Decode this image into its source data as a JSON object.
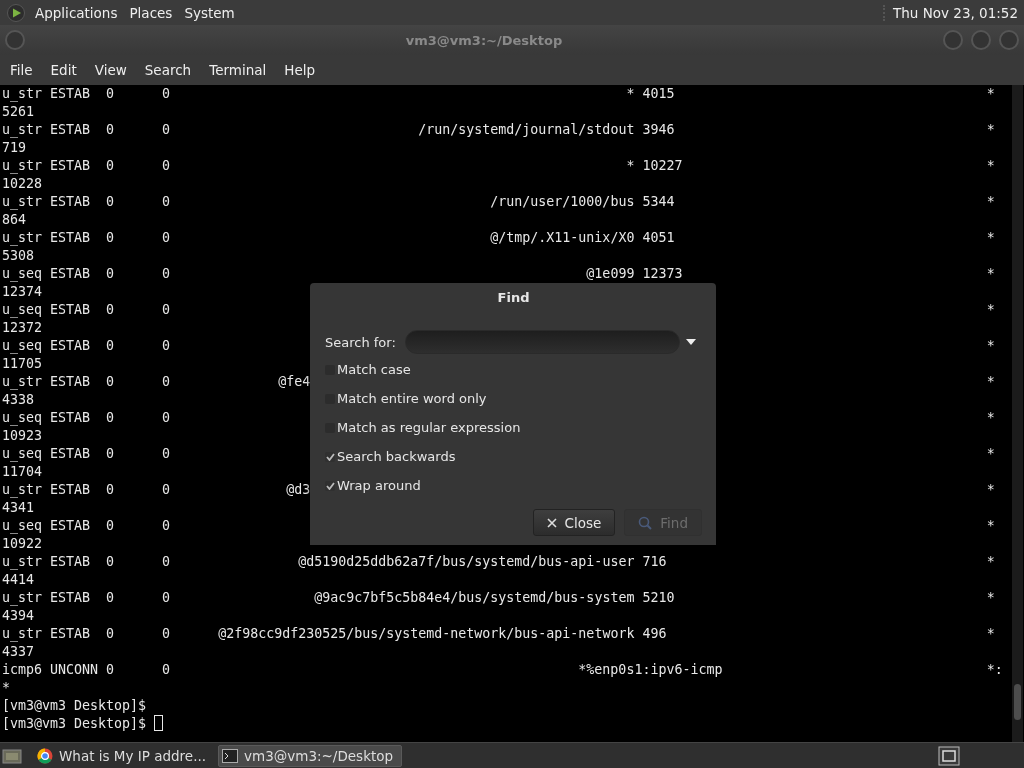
{
  "top_panel": {
    "menus": [
      "Applications",
      "Places",
      "System"
    ],
    "clock": "Thu Nov 23, 01:52"
  },
  "window": {
    "title": "vm3@vm3:~/Desktop",
    "menu": [
      "File",
      "Edit",
      "View",
      "Search",
      "Terminal",
      "Help"
    ]
  },
  "terminal": {
    "rows": [
      {
        "kind": "unix",
        "netid": "u_str",
        "state": "ESTAB",
        "recv_q": "0",
        "send_q": "0",
        "local": "*",
        "local_port": "4015",
        "peer": "*",
        "peer_port": "5261"
      },
      {
        "kind": "unix",
        "netid": "u_str",
        "state": "ESTAB",
        "recv_q": "0",
        "send_q": "0",
        "local": "/run/systemd/journal/stdout",
        "local_port": "3946",
        "peer": "*",
        "peer_port": "719"
      },
      {
        "kind": "unix",
        "netid": "u_str",
        "state": "ESTAB",
        "recv_q": "0",
        "send_q": "0",
        "local": "*",
        "local_port": "10227",
        "peer": "*",
        "peer_port": "10228"
      },
      {
        "kind": "unix",
        "netid": "u_str",
        "state": "ESTAB",
        "recv_q": "0",
        "send_q": "0",
        "local": "/run/user/1000/bus",
        "local_port": "5344",
        "peer": "*",
        "peer_port": "864"
      },
      {
        "kind": "unix",
        "netid": "u_str",
        "state": "ESTAB",
        "recv_q": "0",
        "send_q": "0",
        "local": "@/tmp/.X11-unix/X0",
        "local_port": "4051",
        "peer": "*",
        "peer_port": "5308"
      },
      {
        "kind": "unix",
        "netid": "u_seq",
        "state": "ESTAB",
        "recv_q": "0",
        "send_q": "0",
        "local": "@1e099",
        "local_port": "12373",
        "peer": "*",
        "peer_port": "12374"
      },
      {
        "kind": "hidden",
        "netid": "u_seq",
        "state": "ESTAB",
        "recv_q": "0",
        "send_q": "0",
        "peer": "*",
        "peer_port": "12372"
      },
      {
        "kind": "hidden",
        "netid": "u_seq",
        "state": "ESTAB",
        "recv_q": "0",
        "send_q": "0",
        "peer": "*",
        "peer_port": "11705"
      },
      {
        "kind": "cut",
        "netid": "u_str",
        "state": "ESTAB",
        "recv_q": "0",
        "send_q": "0",
        "local": "@fe4",
        "peer": "*",
        "peer_port": "4338"
      },
      {
        "kind": "hidden",
        "netid": "u_seq",
        "state": "ESTAB",
        "recv_q": "0",
        "send_q": "0",
        "peer": "*",
        "peer_port": "10923"
      },
      {
        "kind": "hidden",
        "netid": "u_seq",
        "state": "ESTAB",
        "recv_q": "0",
        "send_q": "0",
        "peer": "*",
        "peer_port": "11704"
      },
      {
        "kind": "cut",
        "netid": "u_str",
        "state": "ESTAB",
        "recv_q": "0",
        "send_q": "0",
        "local": "@d3",
        "peer": "*",
        "peer_port": "4341"
      },
      {
        "kind": "hidden",
        "netid": "u_seq",
        "state": "ESTAB",
        "recv_q": "0",
        "send_q": "0",
        "peer": "*",
        "peer_port": "10922"
      },
      {
        "kind": "unix",
        "netid": "u_str",
        "state": "ESTAB",
        "recv_q": "0",
        "send_q": "0",
        "local": "@d5190d25ddb62a7f/bus/systemd/bus-api-user",
        "local_port": "716",
        "peer": "*",
        "peer_port": "4414"
      },
      {
        "kind": "unix",
        "netid": "u_str",
        "state": "ESTAB",
        "recv_q": "0",
        "send_q": "0",
        "local": "@9ac9c7bf5c5b84e4/bus/systemd/bus-system",
        "local_port": "5210",
        "peer": "*",
        "peer_port": "4394"
      },
      {
        "kind": "unix",
        "netid": "u_str",
        "state": "ESTAB",
        "recv_q": "0",
        "send_q": "0",
        "local": "@2f98cc9df230525/bus/systemd-network/bus-api-network",
        "local_port": "496",
        "peer": "*",
        "peer_port": "4337"
      },
      {
        "kind": "inet",
        "netid": "icmp6",
        "state": "UNCONN",
        "recv_q": "0",
        "send_q": "0",
        "local": "*%enp0s1:ipv6-icmp",
        "peer": "*:",
        "peer_port": "*"
      }
    ],
    "prompts": [
      "[vm3@vm3 Desktop]$",
      "[vm3@vm3 Desktop]$"
    ]
  },
  "find_dialog": {
    "title": "Find",
    "search_label": "Search for:",
    "options": [
      {
        "label": "Match case",
        "checked": false
      },
      {
        "label": "Match entire word only",
        "checked": false
      },
      {
        "label": "Match as regular expression",
        "checked": false
      },
      {
        "label": "Search backwards",
        "checked": true
      },
      {
        "label": "Wrap around",
        "checked": true
      }
    ],
    "buttons": [
      {
        "kind": "close",
        "label": "Close",
        "disabled": false
      },
      {
        "kind": "find",
        "label": "Find",
        "disabled": true
      }
    ]
  },
  "taskbar": {
    "tasks": [
      {
        "kind": "browser",
        "label": "What is My IP addre...",
        "selected": false
      },
      {
        "kind": "terminal",
        "label": "vm3@vm3:~/Desktop",
        "selected": true
      }
    ]
  }
}
